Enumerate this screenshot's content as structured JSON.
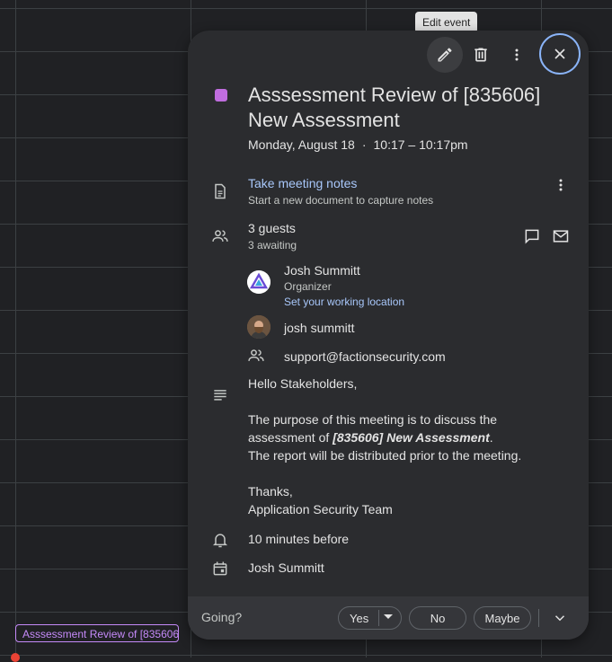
{
  "tooltip": "Edit event",
  "background_event": "Asssessment Review of [835606] New Assessment",
  "event": {
    "title": "Asssessment Review of [835606] New Assessment",
    "date": "Monday, August 18",
    "separator": "·",
    "time": "10:17 – 10:17pm",
    "color": "#c06ddf"
  },
  "notes": {
    "link": "Take meeting notes",
    "subtitle": "Start a new document to capture notes"
  },
  "guests": {
    "count": "3 guests",
    "status": "3 awaiting",
    "list": [
      {
        "name": "Josh Summitt",
        "role": "Organizer",
        "link": "Set your working location"
      },
      {
        "name": "josh summitt"
      },
      {
        "name": "support@factionsecurity.com"
      }
    ]
  },
  "description": {
    "greeting": "Hello Stakeholders,",
    "line1_pre": "The purpose of this meeting is to discuss the assessment of ",
    "line1_bold": "[835606] New Assessment",
    "line1_post": ".",
    "line2": "The report will be distributed prior to the meeting.",
    "signoff": "Thanks,",
    "team": "Application Security Team"
  },
  "reminder": "10 minutes before",
  "calendar_owner": "Josh Summitt",
  "rsvp": {
    "label": "Going?",
    "yes": "Yes",
    "no": "No",
    "maybe": "Maybe"
  },
  "icons": [
    "pencil-icon",
    "trash-icon",
    "more-vert-icon",
    "close-icon",
    "notes-doc-icon",
    "people-icon",
    "chat-icon",
    "mail-icon",
    "group-icon",
    "description-icon",
    "bell-icon",
    "calendar-icon",
    "chevron-down-icon"
  ]
}
